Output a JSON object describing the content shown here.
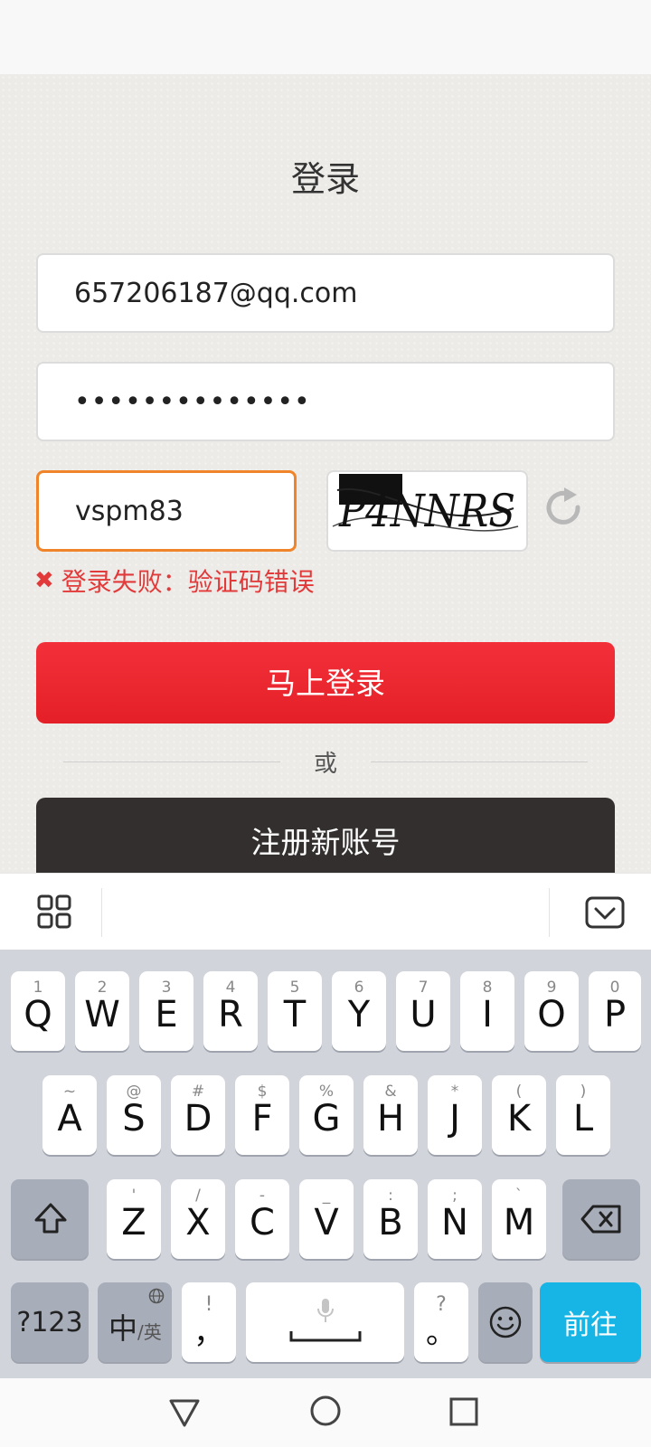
{
  "page": {
    "title": "登录",
    "email_value": "657206187@qq.com",
    "password_value": "••••••••••••••",
    "captcha_value": "vspm83",
    "captcha_image_text": "P4NNRS",
    "error_message": "登录失败：验证码错误",
    "login_button": "马上登录",
    "or_text": "或",
    "register_button": "注册新账号"
  },
  "keyboard": {
    "row1": [
      {
        "main": "Q",
        "hint": "1"
      },
      {
        "main": "W",
        "hint": "2"
      },
      {
        "main": "E",
        "hint": "3"
      },
      {
        "main": "R",
        "hint": "4"
      },
      {
        "main": "T",
        "hint": "5"
      },
      {
        "main": "Y",
        "hint": "6"
      },
      {
        "main": "U",
        "hint": "7"
      },
      {
        "main": "I",
        "hint": "8"
      },
      {
        "main": "O",
        "hint": "9"
      },
      {
        "main": "P",
        "hint": "0"
      }
    ],
    "row2": [
      {
        "main": "A",
        "hint": "~"
      },
      {
        "main": "S",
        "hint": "@"
      },
      {
        "main": "D",
        "hint": "#"
      },
      {
        "main": "F",
        "hint": "$"
      },
      {
        "main": "G",
        "hint": "%"
      },
      {
        "main": "H",
        "hint": "&"
      },
      {
        "main": "J",
        "hint": "*"
      },
      {
        "main": "K",
        "hint": "("
      },
      {
        "main": "L",
        "hint": ")"
      }
    ],
    "row3": [
      {
        "main": "Z",
        "hint": "'"
      },
      {
        "main": "X",
        "hint": "/"
      },
      {
        "main": "C",
        "hint": "-"
      },
      {
        "main": "V",
        "hint": "_"
      },
      {
        "main": "B",
        "hint": ":"
      },
      {
        "main": "N",
        "hint": ";"
      },
      {
        "main": "M",
        "hint": "`"
      }
    ],
    "num_key": "?123",
    "lang_key_main": "中",
    "lang_key_sub": "/英",
    "comma_key": "，",
    "comma_hint": "!",
    "period_key": "。",
    "period_hint": "?",
    "enter_key": "前往"
  },
  "colors": {
    "accent_red": "#e41f27",
    "error_red": "#e23a3a",
    "focus_orange": "#f0842a",
    "enter_blue": "#17b5e5"
  }
}
